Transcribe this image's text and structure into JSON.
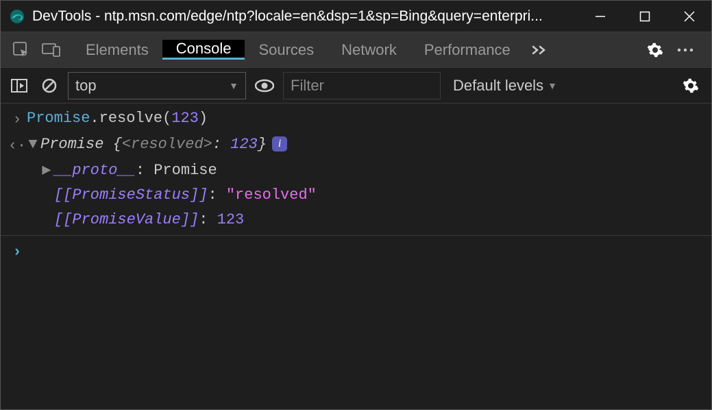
{
  "window": {
    "title": "DevTools - ntp.msn.com/edge/ntp?locale=en&dsp=1&sp=Bing&query=enterpri..."
  },
  "tabs": {
    "elements": "Elements",
    "console": "Console",
    "sources": "Sources",
    "network": "Network",
    "performance": "Performance"
  },
  "toolbar": {
    "context": "top",
    "filter_placeholder": "Filter",
    "levels": "Default levels"
  },
  "console": {
    "input_class": "Promise",
    "input_method": ".resolve(",
    "input_arg": "123",
    "input_close": ")",
    "output_type": "Promise",
    "brace_open": " {",
    "resolved_key": "<resolved>",
    "colon": ": ",
    "resolved_val": "123",
    "brace_close": "}",
    "info_badge": "i",
    "proto_label": "__proto__",
    "proto_value": "Promise",
    "status_slot": "[[PromiseStatus]]",
    "status_value": "\"resolved\"",
    "value_slot": "[[PromiseValue]]",
    "value_value": "123"
  }
}
